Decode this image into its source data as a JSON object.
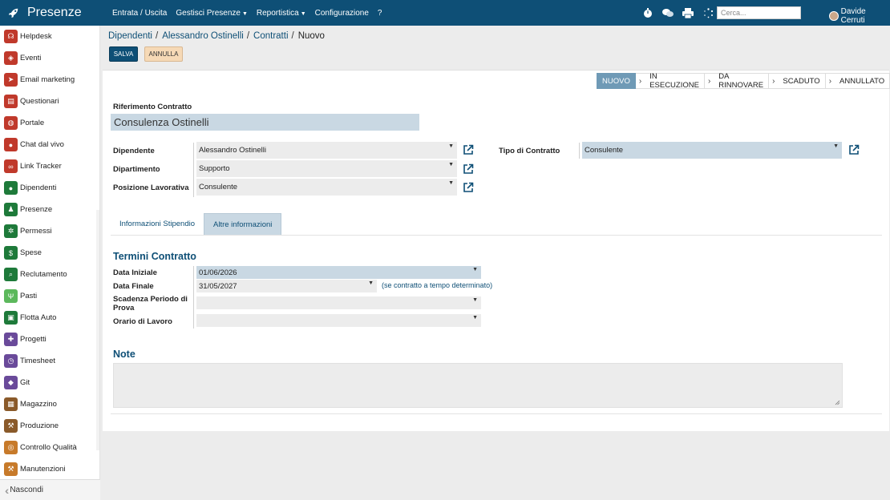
{
  "app": {
    "title": "Presenze"
  },
  "topnav": {
    "items": [
      "Entrata / Uscita",
      "Gestisci Presenze",
      "Reportistica",
      "Configurazione",
      "?"
    ],
    "search_placeholder": "Cerca...",
    "user": "Davide Cerruti",
    "icons": [
      "timer-icon",
      "chat-icon",
      "print-icon",
      "loading-icon"
    ]
  },
  "sidebar": {
    "items": [
      {
        "label": "Helpdesk",
        "color": "#c0392b",
        "icon": "headset-icon"
      },
      {
        "label": "Eventi",
        "color": "#c0392b",
        "icon": "ticket-icon"
      },
      {
        "label": "Email marketing",
        "color": "#c0392b",
        "icon": "paper-plane-icon"
      },
      {
        "label": "Questionari",
        "color": "#c0392b",
        "icon": "clipboard-icon"
      },
      {
        "label": "Portale",
        "color": "#c0392b",
        "icon": "globe-icon"
      },
      {
        "label": "Chat dal vivo",
        "color": "#c0392b",
        "icon": "chat-bubble-icon"
      },
      {
        "label": "Link Tracker",
        "color": "#c0392b",
        "icon": "link-icon"
      },
      {
        "label": "Dipendenti",
        "color": "#1e7a3a",
        "icon": "users-icon"
      },
      {
        "label": "Presenze",
        "color": "#1e7a3a",
        "icon": "user-check-icon"
      },
      {
        "label": "Permessi",
        "color": "#1e7a3a",
        "icon": "sun-icon"
      },
      {
        "label": "Spese",
        "color": "#1e7a3a",
        "icon": "dollar-icon"
      },
      {
        "label": "Reclutamento",
        "color": "#1e7a3a",
        "icon": "search-user-icon"
      },
      {
        "label": "Pasti",
        "color": "#5cb85c",
        "icon": "cutlery-icon"
      },
      {
        "label": "Flotta Auto",
        "color": "#1e7a3a",
        "icon": "car-icon"
      },
      {
        "label": "Progetti",
        "color": "#6a4a9a",
        "icon": "puzzle-icon"
      },
      {
        "label": "Timesheet",
        "color": "#6a4a9a",
        "icon": "clock-icon"
      },
      {
        "label": "Git",
        "color": "#6a4a9a",
        "icon": "git-icon"
      },
      {
        "label": "Magazzino",
        "color": "#8a5a2a",
        "icon": "box-icon"
      },
      {
        "label": "Produzione",
        "color": "#8a5a2a",
        "icon": "wrench-icon"
      },
      {
        "label": "Controllo Qualità",
        "color": "#c77a2a",
        "icon": "quality-icon"
      },
      {
        "label": "Manutenzioni",
        "color": "#c77a2a",
        "icon": "hammer-icon"
      }
    ],
    "footer": "Nascondi"
  },
  "breadcrumb": {
    "items": [
      "Dipendenti",
      "Alessandro Ostinelli",
      "Contratti"
    ],
    "current": "Nuovo"
  },
  "buttons": {
    "save": "SALVA",
    "cancel": "ANNULLA"
  },
  "status": {
    "stages": [
      "NUOVO",
      "IN ESECUZIONE",
      "DA RINNOVARE",
      "SCADUTO",
      "ANNULLATO"
    ],
    "active": "NUOVO"
  },
  "form": {
    "ref_label": "Riferimento Contratto",
    "ref_value": "Consulenza Ostinelli",
    "employee_label": "Dipendente",
    "employee_value": "Alessandro Ostinelli",
    "department_label": "Dipartimento",
    "department_value": "Supporto",
    "position_label": "Posizione Lavorativa",
    "position_value": "Consulente",
    "contract_type_label": "Tipo di Contratto",
    "contract_type_value": "Consulente"
  },
  "tabs": {
    "salary": "Informazioni Stipendio",
    "other": "Altre informazioni"
  },
  "terms": {
    "title": "Termini Contratto",
    "start_label": "Data Iniziale",
    "start_value": "01/06/2026",
    "end_label": "Data Finale",
    "end_value": "31/05/2027",
    "end_hint": "(se contratto a tempo determinato)",
    "trial_label": "Scadenza Periodo di Prova",
    "trial_value": "",
    "schedule_label": "Orario di Lavoro",
    "schedule_value": ""
  },
  "notes": {
    "title": "Note",
    "value": ""
  }
}
